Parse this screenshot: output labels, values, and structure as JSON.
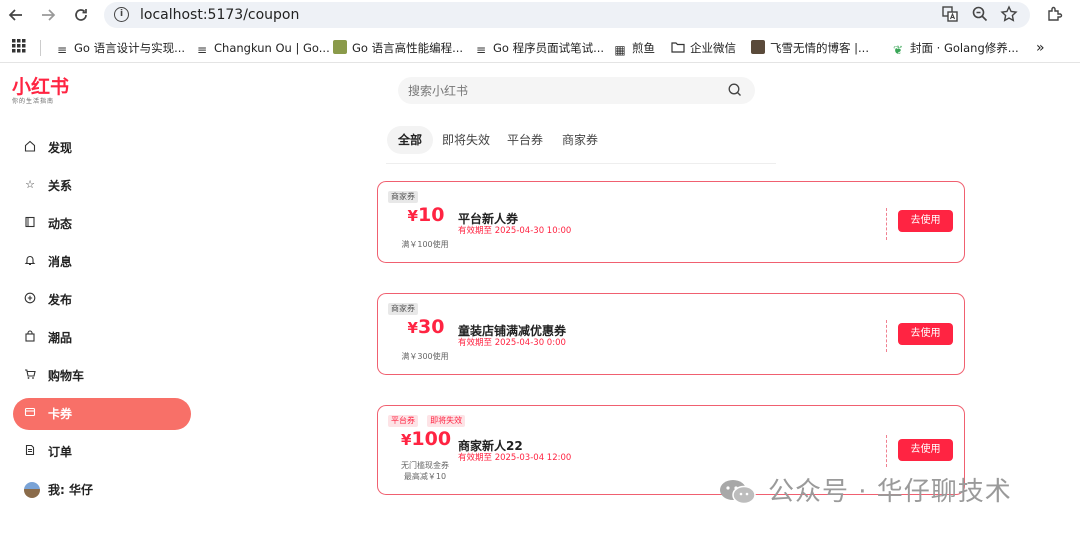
{
  "browser": {
    "url": "localhost:5173/coupon",
    "bookmarks": [
      {
        "label": "Go 语言设计与实现...",
        "icon": "doc-lines-icon"
      },
      {
        "label": "Changkun Ou | Go...",
        "icon": "doc-lines-icon"
      },
      {
        "label": "Go 语言高性能编程...",
        "icon": "image-favicon-icon"
      },
      {
        "label": "Go 程序员面试笔试...",
        "icon": "doc-lines-icon"
      },
      {
        "label": "煎鱼",
        "icon": "grid-favicon-icon"
      },
      {
        "label": "企业微信",
        "icon": "folder-icon"
      },
      {
        "label": "飞雪无情的博客 |...",
        "icon": "avatar-favicon-icon"
      },
      {
        "label": "封面 · Golang修养...",
        "icon": "leaf-favicon-icon"
      }
    ],
    "more": "»"
  },
  "logo": {
    "main": "小红书",
    "sub": "你的生活指南"
  },
  "sidebar": {
    "items": [
      {
        "label": "发现",
        "icon": "home-icon"
      },
      {
        "label": "关系",
        "icon": "star-icon"
      },
      {
        "label": "动态",
        "icon": "book-icon"
      },
      {
        "label": "消息",
        "icon": "bell-icon"
      },
      {
        "label": "发布",
        "icon": "plus-circle-icon"
      },
      {
        "label": "潮品",
        "icon": "bag-icon"
      },
      {
        "label": "购物车",
        "icon": "cart-icon"
      },
      {
        "label": "卡券",
        "icon": "card-icon"
      },
      {
        "label": "订单",
        "icon": "receipt-icon"
      },
      {
        "label": "我: 华仔",
        "icon": "avatar"
      }
    ],
    "active_index": 7
  },
  "search": {
    "placeholder": "搜索小红书"
  },
  "tabs": [
    {
      "label": "全部",
      "active": true
    },
    {
      "label": "即将失效",
      "active": false
    },
    {
      "label": "平台券",
      "active": false
    },
    {
      "label": "商家券",
      "active": false
    }
  ],
  "coupons": [
    {
      "tags": [
        "商家券"
      ],
      "currency": "¥",
      "amount": "10",
      "condition1": "满￥100使用",
      "condition2": "",
      "title": "平台新人券",
      "valid": "有效期至 2025-04-30 10:00",
      "button": "去使用"
    },
    {
      "tags": [
        "商家券"
      ],
      "currency": "¥",
      "amount": "30",
      "condition1": "满￥300使用",
      "condition2": "",
      "title": "童装店铺满减优惠券",
      "valid": "有效期至 2025-04-30 0:00",
      "button": "去使用"
    },
    {
      "tags": [
        "平台券",
        "即将失效"
      ],
      "currency": "¥",
      "amount": "100",
      "condition1": "无门槛现金券",
      "condition2": "最高减￥10",
      "title": "商家新人22",
      "valid": "有效期至 2025-03-04 12:00",
      "button": "去使用"
    }
  ],
  "watermark": "公众号 · 华仔聊技术",
  "colors": {
    "brand": "#ff2442",
    "active_sidebar": "#f87068",
    "coupon_border": "#f06070"
  }
}
